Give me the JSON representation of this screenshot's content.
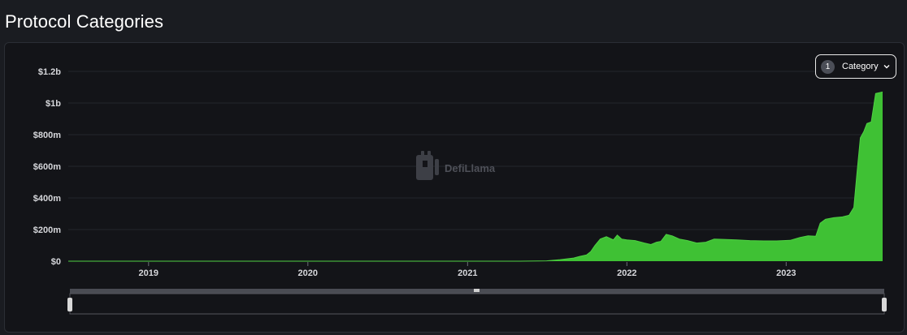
{
  "page": {
    "title": "Protocol Categories"
  },
  "filter": {
    "count": "1",
    "label": "Category"
  },
  "watermark": {
    "text": "DefiLlama"
  },
  "colors": {
    "series": "#3fc134",
    "background": "#131418",
    "grid": "#23262c"
  },
  "chart_data": {
    "type": "area",
    "title": "",
    "xlabel": "",
    "ylabel": "",
    "ylim": [
      0,
      1200000000
    ],
    "yticks": [
      {
        "value": 0,
        "label": "$0"
      },
      {
        "value": 200000000,
        "label": "$200m"
      },
      {
        "value": 400000000,
        "label": "$400m"
      },
      {
        "value": 600000000,
        "label": "$600m"
      },
      {
        "value": 800000000,
        "label": "$800m"
      },
      {
        "value": 1000000000,
        "label": "$1b"
      },
      {
        "value": 1200000000,
        "label": "$1.2b"
      }
    ],
    "xrange": [
      "2018-07-01",
      "2023-08-10"
    ],
    "xticks": [
      {
        "value": "2019-01-01",
        "label": "2019"
      },
      {
        "value": "2020-01-01",
        "label": "2020"
      },
      {
        "value": "2021-01-01",
        "label": "2021"
      },
      {
        "value": "2022-01-01",
        "label": "2022"
      },
      {
        "value": "2023-01-01",
        "label": "2023"
      }
    ],
    "grid": true,
    "series": [
      {
        "color": "#3fc134",
        "points": [
          [
            "2018-07-01",
            0
          ],
          [
            "2021-05-01",
            0
          ],
          [
            "2021-07-01",
            2000000
          ],
          [
            "2021-08-01",
            10000000
          ],
          [
            "2021-09-01",
            20000000
          ],
          [
            "2021-09-15",
            30000000
          ],
          [
            "2021-10-01",
            40000000
          ],
          [
            "2021-10-10",
            60000000
          ],
          [
            "2021-10-20",
            100000000
          ],
          [
            "2021-11-01",
            140000000
          ],
          [
            "2021-11-15",
            155000000
          ],
          [
            "2021-12-01",
            135000000
          ],
          [
            "2021-12-10",
            165000000
          ],
          [
            "2021-12-20",
            140000000
          ],
          [
            "2022-01-01",
            135000000
          ],
          [
            "2022-01-20",
            130000000
          ],
          [
            "2022-02-10",
            115000000
          ],
          [
            "2022-02-25",
            105000000
          ],
          [
            "2022-03-10",
            120000000
          ],
          [
            "2022-03-20",
            125000000
          ],
          [
            "2022-04-01",
            170000000
          ],
          [
            "2022-04-15",
            160000000
          ],
          [
            "2022-05-01",
            140000000
          ],
          [
            "2022-05-20",
            130000000
          ],
          [
            "2022-06-10",
            115000000
          ],
          [
            "2022-07-01",
            120000000
          ],
          [
            "2022-07-20",
            140000000
          ],
          [
            "2022-08-10",
            138000000
          ],
          [
            "2022-09-10",
            135000000
          ],
          [
            "2022-10-10",
            130000000
          ],
          [
            "2022-11-10",
            128000000
          ],
          [
            "2022-12-10",
            128000000
          ],
          [
            "2023-01-10",
            132000000
          ],
          [
            "2023-02-01",
            150000000
          ],
          [
            "2023-02-20",
            160000000
          ],
          [
            "2023-03-10",
            158000000
          ],
          [
            "2023-03-20",
            240000000
          ],
          [
            "2023-04-01",
            265000000
          ],
          [
            "2023-04-20",
            275000000
          ],
          [
            "2023-05-10",
            280000000
          ],
          [
            "2023-05-25",
            290000000
          ],
          [
            "2023-06-05",
            340000000
          ],
          [
            "2023-06-12",
            550000000
          ],
          [
            "2023-06-20",
            780000000
          ],
          [
            "2023-06-28",
            820000000
          ],
          [
            "2023-07-05",
            870000000
          ],
          [
            "2023-07-15",
            880000000
          ],
          [
            "2023-07-25",
            1060000000
          ],
          [
            "2023-08-10",
            1070000000
          ]
        ]
      }
    ]
  }
}
